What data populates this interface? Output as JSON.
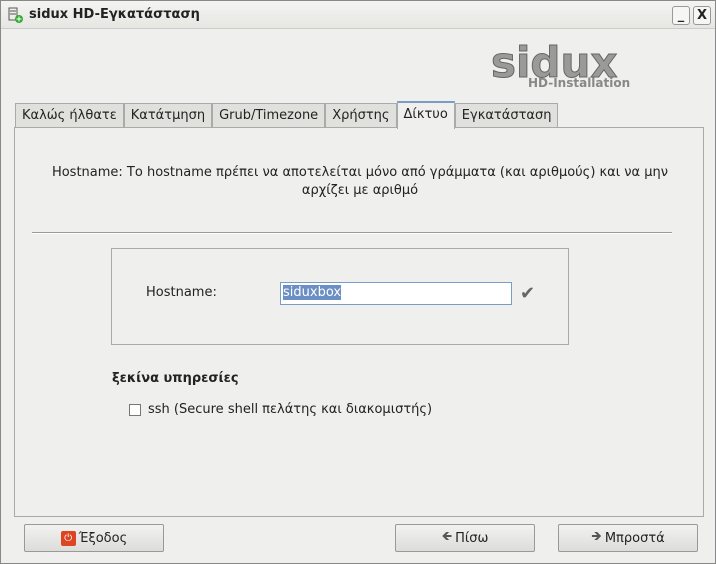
{
  "window": {
    "title": "sidux HD-Εγκατάσταση",
    "minimize": "_",
    "close": "X"
  },
  "logo": {
    "main": "sidux",
    "sub": "HD-Installation"
  },
  "tabs": [
    {
      "label": "Καλώς ήλθατε"
    },
    {
      "label": "Κατάτμηση"
    },
    {
      "label": "Grub/Timezone"
    },
    {
      "label": "Χρήστης"
    },
    {
      "label": "Δίκτυο",
      "active": true
    },
    {
      "label": "Εγκατάσταση"
    }
  ],
  "main": {
    "info": "Hostname: Το hostname πρέπει να αποτελείται μόνο από γράμματα (και αριθμούς) και να μην αρχίζει με αριθμό",
    "hostname_label": "Hostname:",
    "hostname_value": "siduxbox",
    "check_icon": "✔",
    "services_heading": "ξεκίνα υπηρεσίες",
    "ssh_label": "ssh (Secure shell πελάτης και διακομιστής)",
    "ssh_checked": false
  },
  "buttons": {
    "exit": "Έξοδος",
    "back": "Πίσω",
    "next": "Μπροστά"
  }
}
